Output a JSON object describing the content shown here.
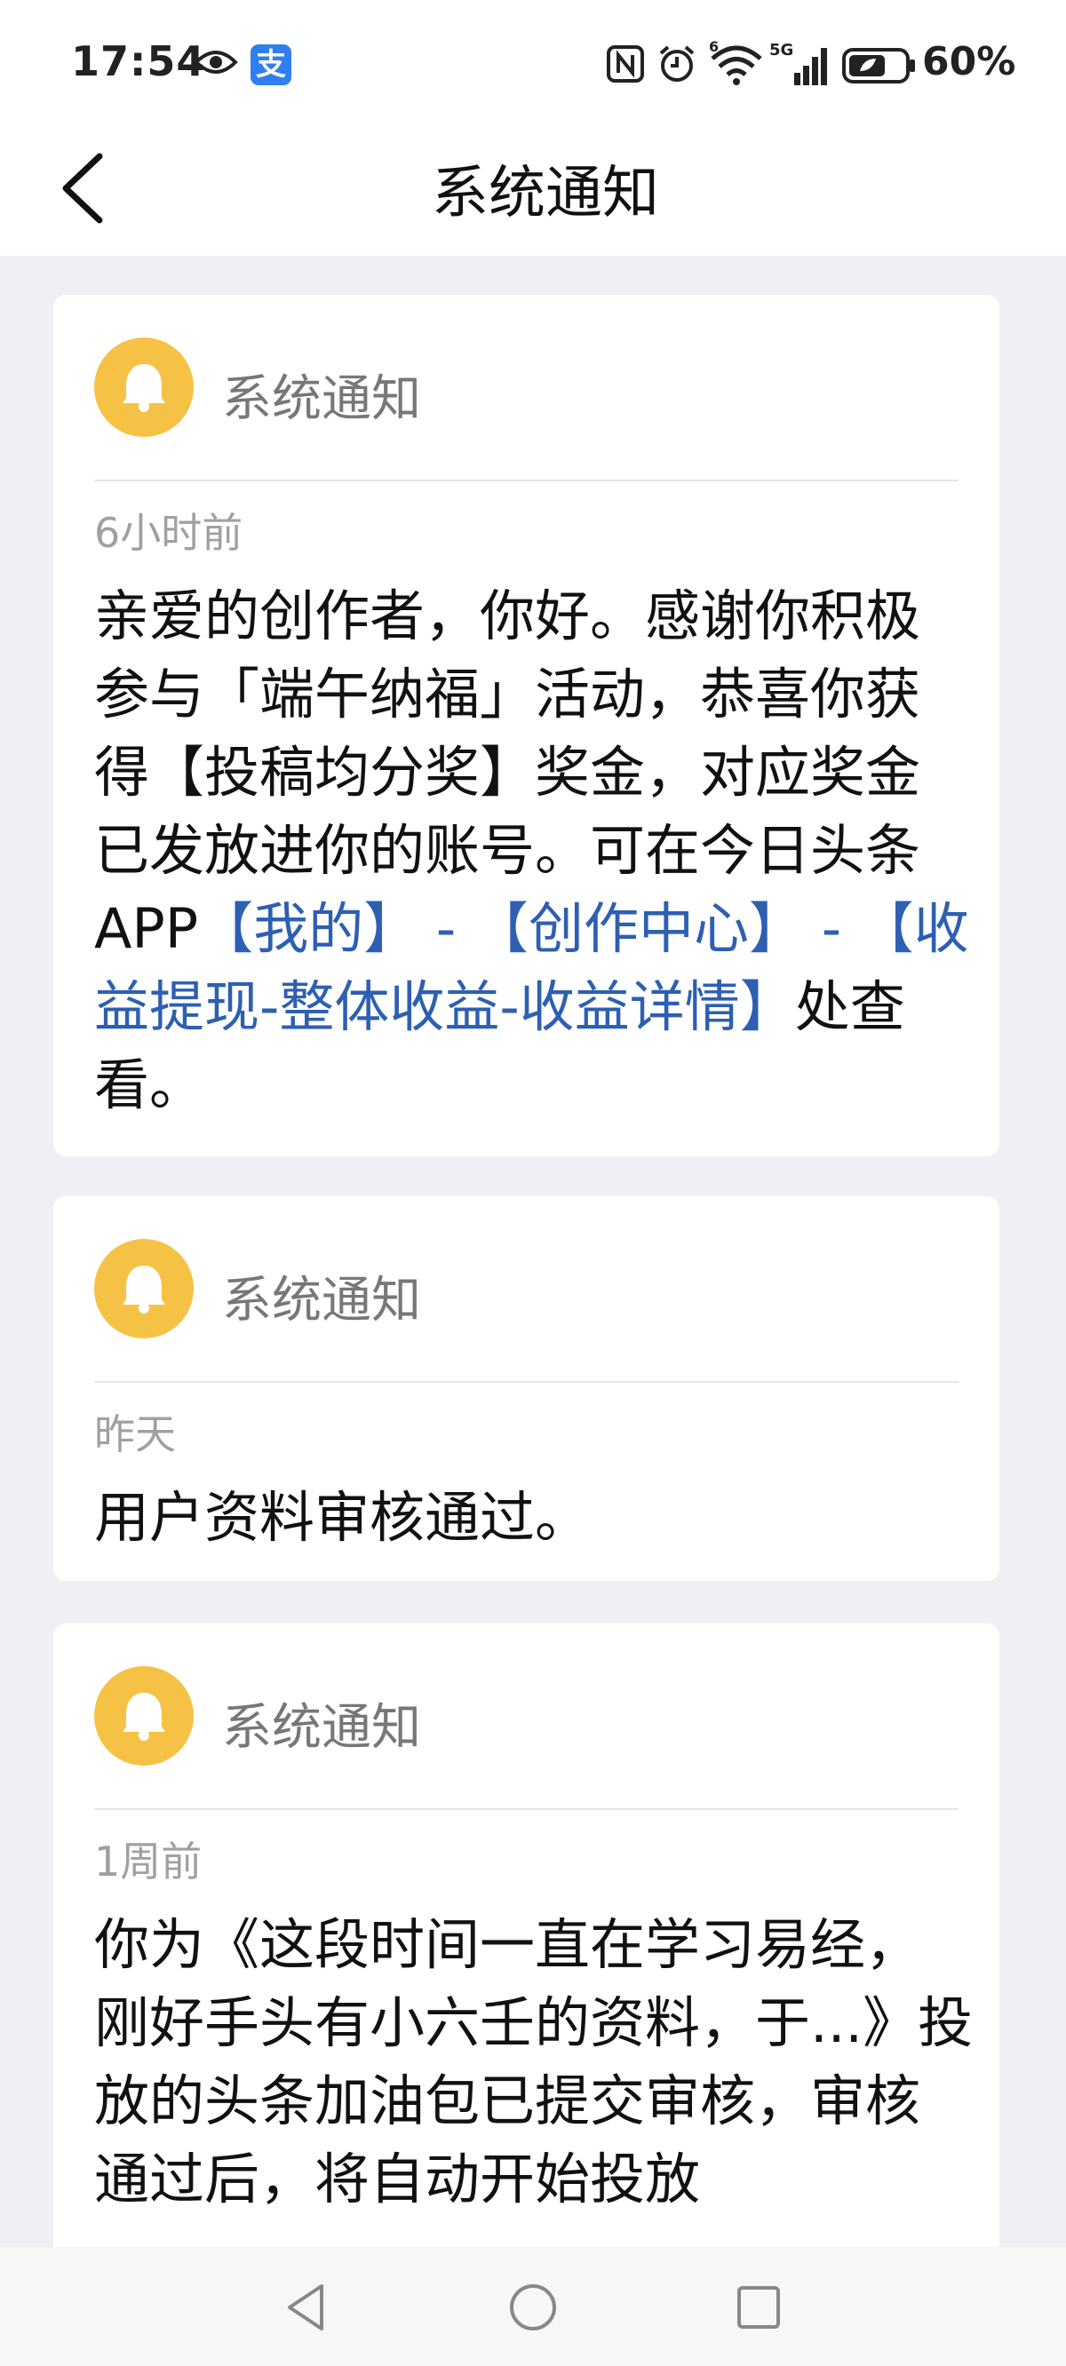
{
  "status_bar": {
    "time": "17:54",
    "battery": "60%",
    "network": "5G",
    "wifi_badge": "6",
    "icons": [
      "eye-icon",
      "alipay-icon",
      "nfc-icon",
      "alarm-icon",
      "wifi-icon",
      "signal-icon",
      "battery-icon"
    ],
    "alipay_glyph": "支"
  },
  "nav": {
    "title": "系统通知",
    "back_icon": "chevron-left-icon"
  },
  "notifications": [
    {
      "sender": "系统通知",
      "icon": "bell-icon",
      "time": "6小时前",
      "segments": [
        {
          "text": "亲爱的创作者，你好。感谢你积极参与「端午纳福」活动，恭喜你获得【投稿均分奖】奖金，对应奖金已发放进你的账号。可在今日头条APP",
          "link": false
        },
        {
          "text": "【我的】 - 【创作中心】 - 【收益提现-整体收益-收益详情】",
          "link": true
        },
        {
          "text": "处查看。",
          "link": false
        }
      ]
    },
    {
      "sender": "系统通知",
      "icon": "bell-icon",
      "time": "昨天",
      "message": "用户资料审核通过。"
    },
    {
      "sender": "系统通知",
      "icon": "bell-icon",
      "time": "1周前",
      "message": "你为《这段时间一直在学习易经，刚好手头有小六壬的资料，于...》投放的头条加油包已提交审核，审核通过后，将自动开始投放"
    }
  ],
  "colors": {
    "background": "#eef0f4",
    "card": "#ffffff",
    "bell": "#f6c246",
    "link": "#2d5fb3",
    "time_text": "#a0a0a0"
  },
  "system_nav": [
    "back-triangle-icon",
    "home-circle-icon",
    "recents-square-icon"
  ]
}
